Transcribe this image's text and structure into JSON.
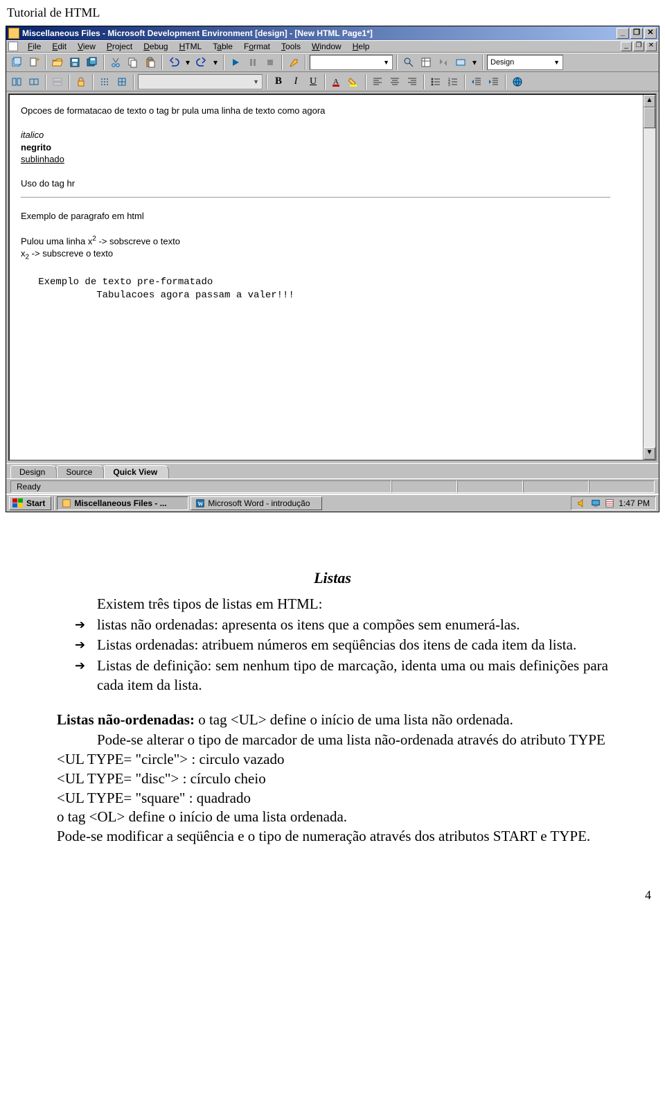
{
  "page_header": "Tutorial de HTML",
  "page_number": "4",
  "ide": {
    "title": "Miscellaneous Files - Microsoft Development Environment [design] - [New HTML Page1*]",
    "menus": [
      "File",
      "Edit",
      "View",
      "Project",
      "Debug",
      "HTML",
      "Table",
      "Format",
      "Tools",
      "Window",
      "Help"
    ],
    "toolbar_mode": "Design",
    "editor_tabs": [
      "Design",
      "Source",
      "Quick View"
    ],
    "active_tab": "Quick View",
    "status": "Ready",
    "content": {
      "line_intro": "Opcoes de formatacao de texto o tag br pula uma linha de texto como agora",
      "italic": "italico",
      "bold": "negrito",
      "under": "sublinhado",
      "hr_label": "Uso do tag hr",
      "para_ex": "Exemplo de paragrafo em html",
      "sup_line_a": "Pulou uma linha x",
      "sup_exp": "2",
      "sup_line_b": " -> sobscreve o texto",
      "sub_line_a": "x",
      "sub_exp": "2",
      "sub_line_b": " -> subscreve o texto",
      "pre_l1": "   Exemplo de texto pre-formatado",
      "pre_l2": "             Tabulacoes agora passam a valer!!!"
    }
  },
  "taskbar": {
    "start": "Start",
    "task1": "Miscellaneous Files - ...",
    "task2": "Microsoft Word - introdução",
    "clock": "1:47 PM"
  },
  "doc": {
    "title": "Listas",
    "intro": "Existem três tipos de listas em HTML:",
    "bullets": [
      "listas não ordenadas: apresenta os itens que a compões sem enumerá-las.",
      "Listas ordenadas: atribuem números em seqüências dos itens de cada item da lista.",
      "Listas de definição: sem nenhum tipo de marcação, identa uma ou mais definições para cada item da lista."
    ],
    "s1_label": "Listas não-ordenadas:",
    "s1_text": " o tag <UL> define o início de uma lista não ordenada.",
    "s1_p2": "Pode-se alterar o tipo de marcador de uma lista não-ordenada através do atributo TYPE",
    "s1_l1": "<UL TYPE= \"circle\"> : circulo vazado",
    "s1_l2": "<UL TYPE= \"disc\">   : círculo cheio",
    "s1_l3": "<UL TYPE= \"square\" : quadrado",
    "s2_l1": "o tag <OL> define o início de uma lista ordenada.",
    "s2_l2": "Pode-se modificar a seqüência e o tipo de numeração através dos atributos START e TYPE."
  }
}
